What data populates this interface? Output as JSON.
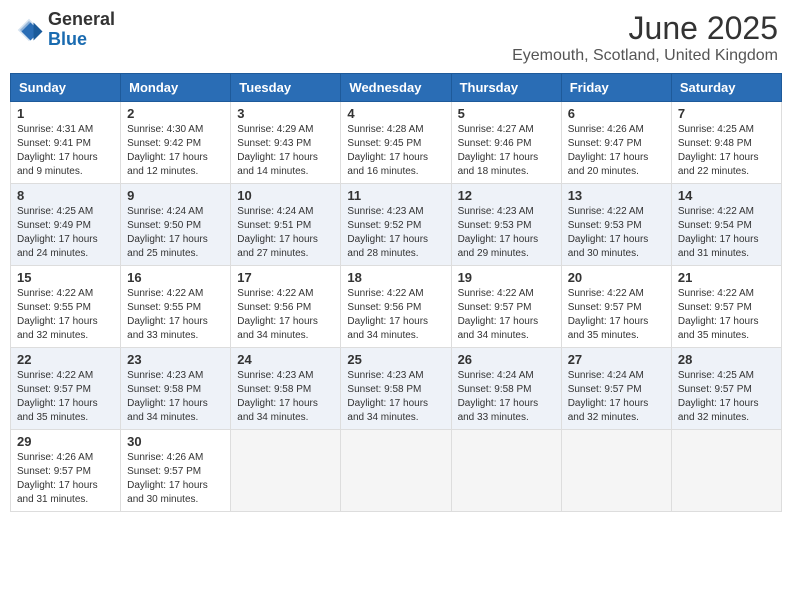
{
  "header": {
    "logo_general": "General",
    "logo_blue": "Blue",
    "month_title": "June 2025",
    "location": "Eyemouth, Scotland, United Kingdom"
  },
  "calendar": {
    "days_of_week": [
      "Sunday",
      "Monday",
      "Tuesday",
      "Wednesday",
      "Thursday",
      "Friday",
      "Saturday"
    ],
    "weeks": [
      [
        null,
        {
          "day": "2",
          "sunrise": "Sunrise: 4:30 AM",
          "sunset": "Sunset: 9:42 PM",
          "daylight": "Daylight: 17 hours and 12 minutes."
        },
        {
          "day": "3",
          "sunrise": "Sunrise: 4:29 AM",
          "sunset": "Sunset: 9:43 PM",
          "daylight": "Daylight: 17 hours and 14 minutes."
        },
        {
          "day": "4",
          "sunrise": "Sunrise: 4:28 AM",
          "sunset": "Sunset: 9:45 PM",
          "daylight": "Daylight: 17 hours and 16 minutes."
        },
        {
          "day": "5",
          "sunrise": "Sunrise: 4:27 AM",
          "sunset": "Sunset: 9:46 PM",
          "daylight": "Daylight: 17 hours and 18 minutes."
        },
        {
          "day": "6",
          "sunrise": "Sunrise: 4:26 AM",
          "sunset": "Sunset: 9:47 PM",
          "daylight": "Daylight: 17 hours and 20 minutes."
        },
        {
          "day": "7",
          "sunrise": "Sunrise: 4:25 AM",
          "sunset": "Sunset: 9:48 PM",
          "daylight": "Daylight: 17 hours and 22 minutes."
        }
      ],
      [
        {
          "day": "1",
          "sunrise": "Sunrise: 4:31 AM",
          "sunset": "Sunset: 9:41 PM",
          "daylight": "Daylight: 17 hours and 9 minutes."
        },
        null,
        null,
        null,
        null,
        null,
        null
      ],
      [
        {
          "day": "8",
          "sunrise": "Sunrise: 4:25 AM",
          "sunset": "Sunset: 9:49 PM",
          "daylight": "Daylight: 17 hours and 24 minutes."
        },
        {
          "day": "9",
          "sunrise": "Sunrise: 4:24 AM",
          "sunset": "Sunset: 9:50 PM",
          "daylight": "Daylight: 17 hours and 25 minutes."
        },
        {
          "day": "10",
          "sunrise": "Sunrise: 4:24 AM",
          "sunset": "Sunset: 9:51 PM",
          "daylight": "Daylight: 17 hours and 27 minutes."
        },
        {
          "day": "11",
          "sunrise": "Sunrise: 4:23 AM",
          "sunset": "Sunset: 9:52 PM",
          "daylight": "Daylight: 17 hours and 28 minutes."
        },
        {
          "day": "12",
          "sunrise": "Sunrise: 4:23 AM",
          "sunset": "Sunset: 9:53 PM",
          "daylight": "Daylight: 17 hours and 29 minutes."
        },
        {
          "day": "13",
          "sunrise": "Sunrise: 4:22 AM",
          "sunset": "Sunset: 9:53 PM",
          "daylight": "Daylight: 17 hours and 30 minutes."
        },
        {
          "day": "14",
          "sunrise": "Sunrise: 4:22 AM",
          "sunset": "Sunset: 9:54 PM",
          "daylight": "Daylight: 17 hours and 31 minutes."
        }
      ],
      [
        {
          "day": "15",
          "sunrise": "Sunrise: 4:22 AM",
          "sunset": "Sunset: 9:55 PM",
          "daylight": "Daylight: 17 hours and 32 minutes."
        },
        {
          "day": "16",
          "sunrise": "Sunrise: 4:22 AM",
          "sunset": "Sunset: 9:55 PM",
          "daylight": "Daylight: 17 hours and 33 minutes."
        },
        {
          "day": "17",
          "sunrise": "Sunrise: 4:22 AM",
          "sunset": "Sunset: 9:56 PM",
          "daylight": "Daylight: 17 hours and 34 minutes."
        },
        {
          "day": "18",
          "sunrise": "Sunrise: 4:22 AM",
          "sunset": "Sunset: 9:56 PM",
          "daylight": "Daylight: 17 hours and 34 minutes."
        },
        {
          "day": "19",
          "sunrise": "Sunrise: 4:22 AM",
          "sunset": "Sunset: 9:57 PM",
          "daylight": "Daylight: 17 hours and 34 minutes."
        },
        {
          "day": "20",
          "sunrise": "Sunrise: 4:22 AM",
          "sunset": "Sunset: 9:57 PM",
          "daylight": "Daylight: 17 hours and 35 minutes."
        },
        {
          "day": "21",
          "sunrise": "Sunrise: 4:22 AM",
          "sunset": "Sunset: 9:57 PM",
          "daylight": "Daylight: 17 hours and 35 minutes."
        }
      ],
      [
        {
          "day": "22",
          "sunrise": "Sunrise: 4:22 AM",
          "sunset": "Sunset: 9:57 PM",
          "daylight": "Daylight: 17 hours and 35 minutes."
        },
        {
          "day": "23",
          "sunrise": "Sunrise: 4:23 AM",
          "sunset": "Sunset: 9:58 PM",
          "daylight": "Daylight: 17 hours and 34 minutes."
        },
        {
          "day": "24",
          "sunrise": "Sunrise: 4:23 AM",
          "sunset": "Sunset: 9:58 PM",
          "daylight": "Daylight: 17 hours and 34 minutes."
        },
        {
          "day": "25",
          "sunrise": "Sunrise: 4:23 AM",
          "sunset": "Sunset: 9:58 PM",
          "daylight": "Daylight: 17 hours and 34 minutes."
        },
        {
          "day": "26",
          "sunrise": "Sunrise: 4:24 AM",
          "sunset": "Sunset: 9:58 PM",
          "daylight": "Daylight: 17 hours and 33 minutes."
        },
        {
          "day": "27",
          "sunrise": "Sunrise: 4:24 AM",
          "sunset": "Sunset: 9:57 PM",
          "daylight": "Daylight: 17 hours and 32 minutes."
        },
        {
          "day": "28",
          "sunrise": "Sunrise: 4:25 AM",
          "sunset": "Sunset: 9:57 PM",
          "daylight": "Daylight: 17 hours and 32 minutes."
        }
      ],
      [
        {
          "day": "29",
          "sunrise": "Sunrise: 4:26 AM",
          "sunset": "Sunset: 9:57 PM",
          "daylight": "Daylight: 17 hours and 31 minutes."
        },
        {
          "day": "30",
          "sunrise": "Sunrise: 4:26 AM",
          "sunset": "Sunset: 9:57 PM",
          "daylight": "Daylight: 17 hours and 30 minutes."
        },
        null,
        null,
        null,
        null,
        null
      ]
    ]
  }
}
